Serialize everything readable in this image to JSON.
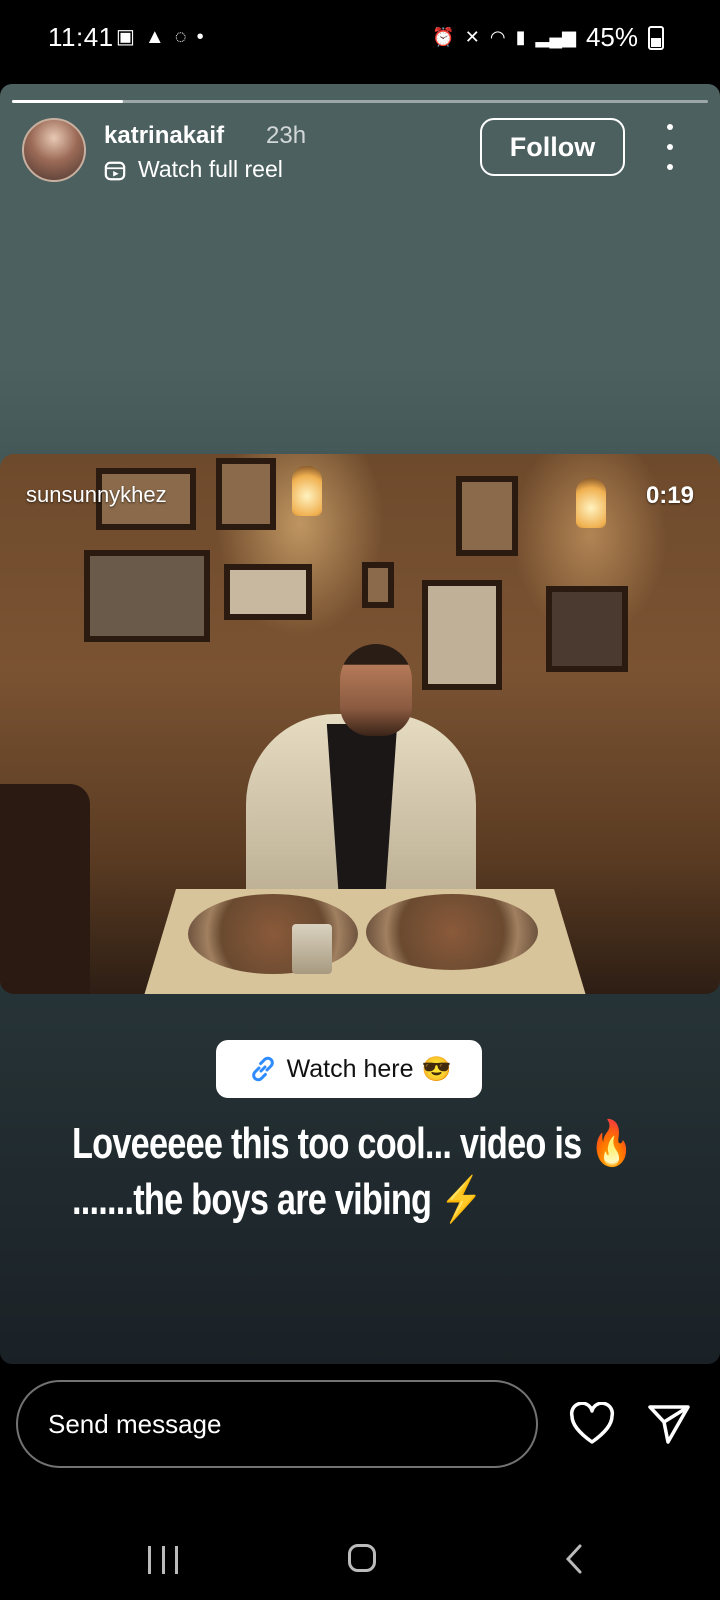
{
  "status_bar": {
    "time": "11:41",
    "left_icons": [
      "gallery-icon",
      "warning-icon",
      "whatsapp-icon",
      "dot-icon"
    ],
    "right_icons": [
      "alarm-icon",
      "mute-icon",
      "wifi-icon",
      "volte-lte-icon",
      "signal-icon",
      "signal-icon"
    ],
    "battery": "45%"
  },
  "story": {
    "progress": 0.16,
    "username": "katrinakaif",
    "time_ago": "23h",
    "reel_link": "Watch full reel",
    "follow_label": "Follow"
  },
  "video": {
    "author": "sunsunnykhez",
    "duration": "0:19"
  },
  "link_sticker": {
    "label": "Watch here",
    "emoji": "😎"
  },
  "caption": {
    "line1": "Loveeeee this too cool... video is 🔥",
    "line2": ".......the boys are vibing ⚡"
  },
  "bottom_bar": {
    "message_placeholder": "Send message"
  },
  "colors": {
    "story_top": "#4b605f",
    "story_bottom": "#1a2126",
    "link_icon": "#2f8cff"
  }
}
